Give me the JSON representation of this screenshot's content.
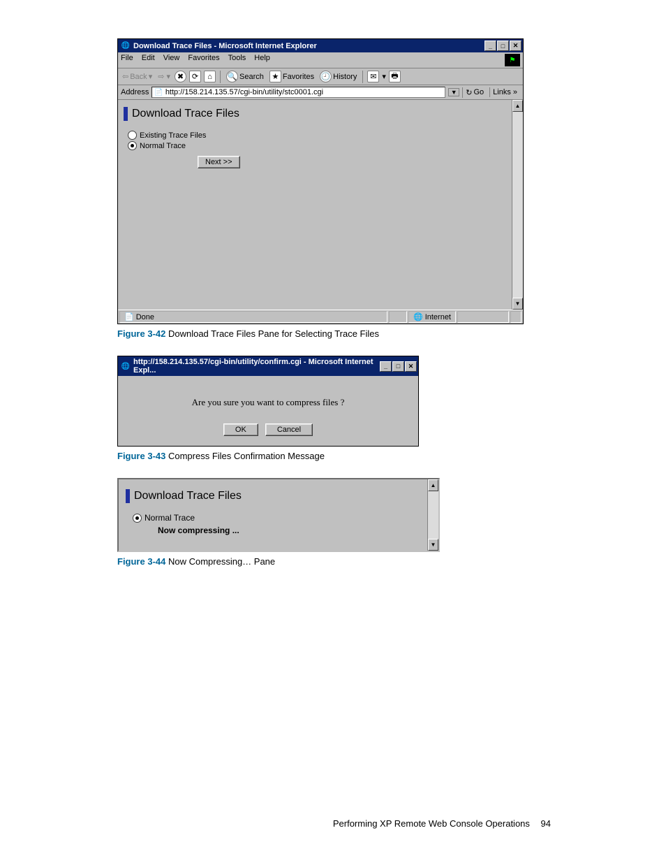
{
  "fig1": {
    "titlebar": "Download Trace Files - Microsoft Internet Explorer",
    "menus": [
      "File",
      "Edit",
      "View",
      "Favorites",
      "Tools",
      "Help"
    ],
    "toolbar": {
      "back": "Back",
      "search": "Search",
      "favorites": "Favorites",
      "history": "History"
    },
    "address_label": "Address",
    "address_url": "http://158.214.135.57/cgi-bin/utility/stc0001.cgi",
    "go": "Go",
    "links": "Links »",
    "pane_title": "Download Trace Files",
    "radio1": "Existing Trace Files",
    "radio2": "Normal Trace",
    "next": "Next >>",
    "status_done": "Done",
    "status_zone": "Internet"
  },
  "caption1": {
    "num": "Figure 3-42",
    "text": " Download Trace Files Pane for Selecting Trace Files"
  },
  "fig2": {
    "titlebar": "http://158.214.135.57/cgi-bin/utility/confirm.cgi - Microsoft Internet Expl...",
    "message": "Are you sure you want to compress files ?",
    "ok": "OK",
    "cancel": "Cancel"
  },
  "caption2": {
    "num": "Figure 3-43",
    "text": " Compress Files Confirmation Message"
  },
  "fig3": {
    "pane_title": "Download Trace Files",
    "radio": "Normal Trace",
    "status": "Now compressing ..."
  },
  "caption3": {
    "num": "Figure 3-44",
    "text": " Now Compressing… Pane"
  },
  "footer": {
    "text": "Performing XP Remote Web Console Operations",
    "page": "94"
  }
}
